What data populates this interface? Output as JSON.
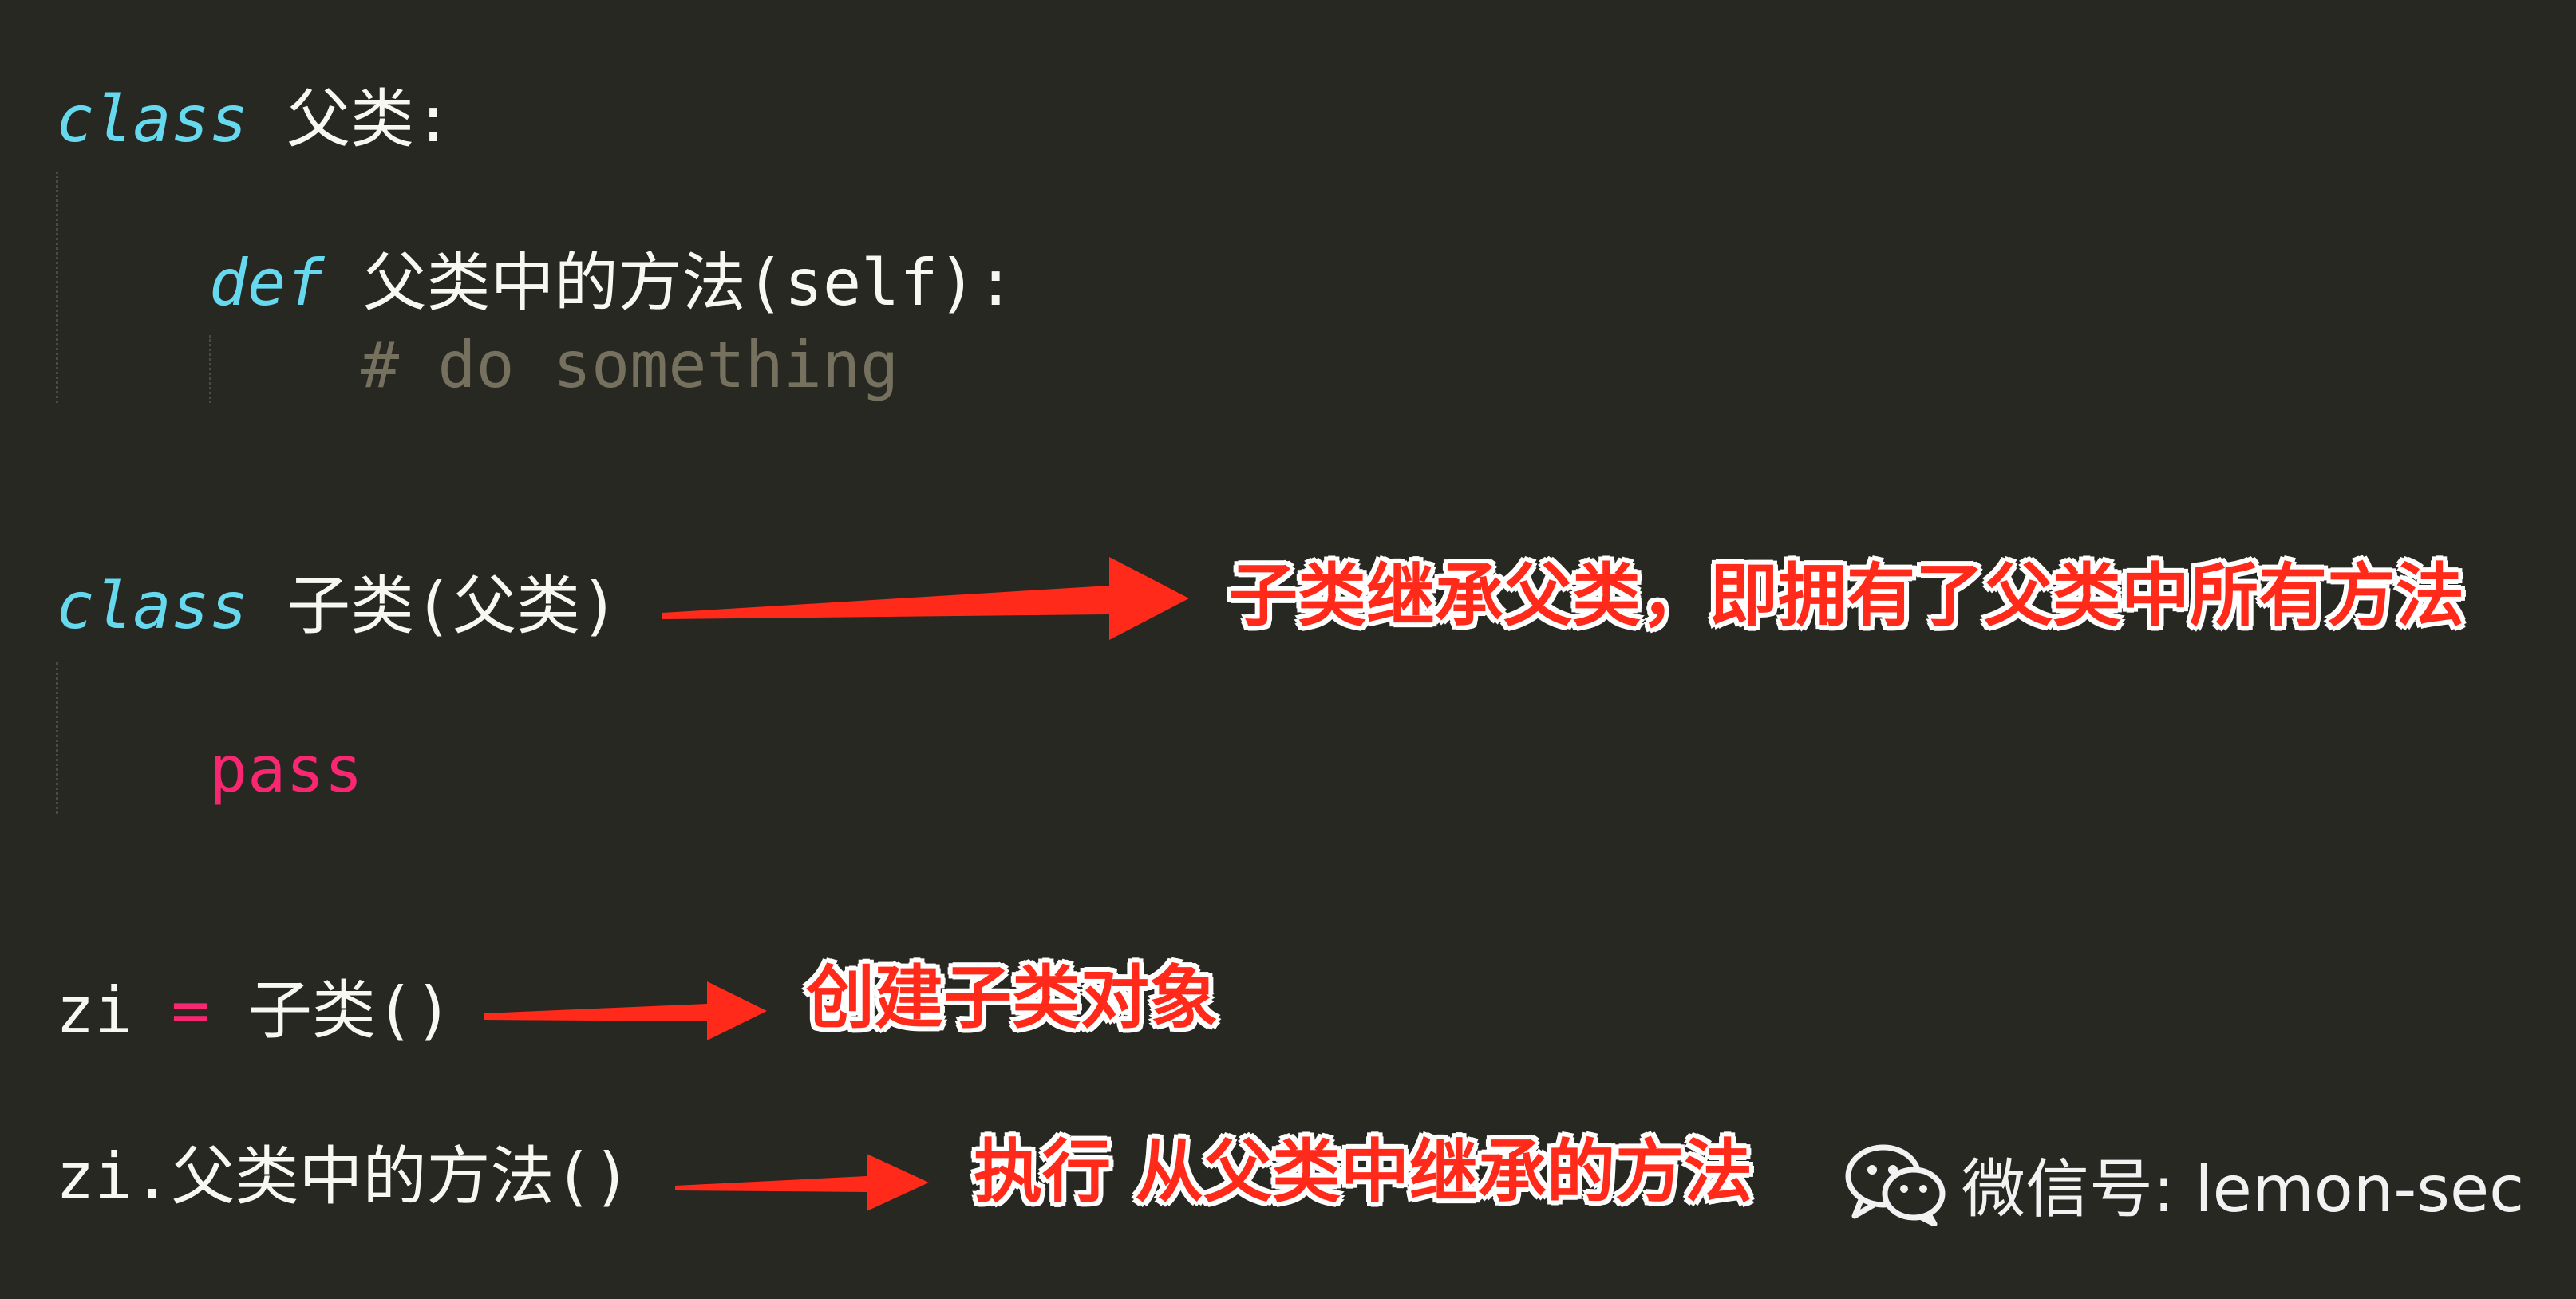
{
  "code": {
    "line1": {
      "kw": "class",
      "name": "父类",
      "colon": ":"
    },
    "line2": {
      "kw": "def",
      "sig": "父类中的方法(self):"
    },
    "line3": {
      "comment": "# do something"
    },
    "line4": {
      "kw": "class",
      "rest": "子类(父类)"
    },
    "line5": {
      "kw": "pass"
    },
    "line6": {
      "var": "zi",
      "eq": "=",
      "call": "子类()"
    },
    "line7": {
      "text": "zi.父类中的方法()"
    }
  },
  "annotations": {
    "inherit": "子类继承父类，即拥有了父类中所有方法",
    "create": "创建子类对象",
    "execute": "执行 从父类中继承的方法"
  },
  "watermark": {
    "icon": "wechat-icon",
    "text": "微信号: lemon-sec"
  },
  "colors": {
    "background": "#272822",
    "keyword": "#66d9ef",
    "pass_keyword": "#f92672",
    "comment": "#75715e",
    "annotation": "#ff2a1a"
  }
}
